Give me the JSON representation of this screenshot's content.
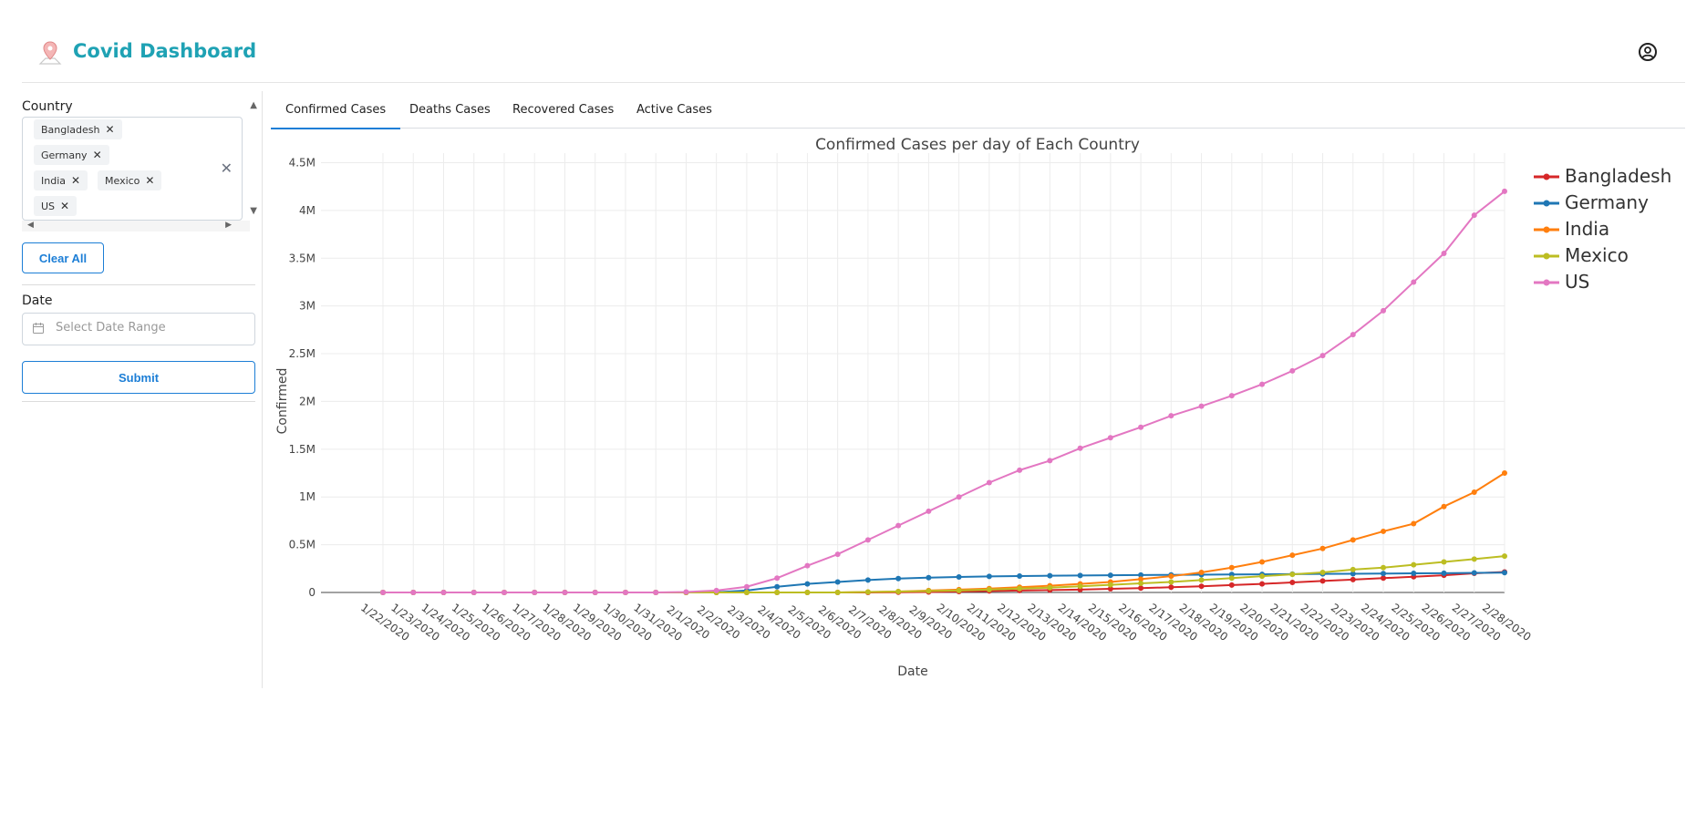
{
  "header": {
    "title": "Covid Dashboard",
    "logo_icon": "map-pin-icon",
    "profile_icon": "user-circle-icon"
  },
  "sidebar": {
    "country_label": "Country",
    "selected_countries": [
      "Bangladesh",
      "Germany",
      "India",
      "Mexico",
      "US"
    ],
    "clear_all_label": "Clear All",
    "date_label": "Date",
    "date_placeholder": "Select Date Range",
    "submit_label": "Submit"
  },
  "tabs": [
    "Confirmed Cases",
    "Deaths Cases",
    "Recovered Cases",
    "Active Cases"
  ],
  "active_tab": 0,
  "chart_data": {
    "type": "line",
    "title": "Confirmed Cases per day of Each Country",
    "xlabel": "Date",
    "ylabel": "Confirmed",
    "ylim": [
      0,
      4600000
    ],
    "yticks": [
      0,
      500000,
      1000000,
      1500000,
      2000000,
      2500000,
      3000000,
      3500000,
      4000000,
      4500000
    ],
    "ytick_labels": [
      "0",
      "0.5M",
      "1M",
      "1.5M",
      "2M",
      "2.5M",
      "3M",
      "3.5M",
      "4M",
      "4.5M"
    ],
    "categories": [
      "1/22/2020",
      "1/23/2020",
      "1/24/2020",
      "1/25/2020",
      "1/26/2020",
      "1/27/2020",
      "1/28/2020",
      "1/29/2020",
      "1/30/2020",
      "1/31/2020",
      "2/1/2020",
      "2/2/2020",
      "2/3/2020",
      "2/4/2020",
      "2/5/2020",
      "2/6/2020",
      "2/7/2020",
      "2/8/2020",
      "2/9/2020",
      "2/10/2020",
      "2/11/2020",
      "2/12/2020",
      "2/13/2020",
      "2/14/2020",
      "2/15/2020",
      "2/16/2020",
      "2/17/2020",
      "2/18/2020",
      "2/19/2020",
      "2/20/2020",
      "2/21/2020",
      "2/22/2020",
      "2/23/2020",
      "2/24/2020",
      "2/25/2020",
      "2/26/2020",
      "2/27/2020",
      "2/28/2020"
    ],
    "legend_position": "right",
    "grid": true,
    "series": [
      {
        "name": "Bangladesh",
        "color": "#d62728",
        "values": [
          0,
          0,
          0,
          0,
          0,
          0,
          0,
          0,
          0,
          0,
          0,
          0,
          0,
          0,
          0,
          0,
          0,
          2000,
          5000,
          9000,
          15000,
          20000,
          25000,
          30000,
          38000,
          45000,
          55000,
          65000,
          78000,
          90000,
          105000,
          120000,
          135000,
          150000,
          165000,
          180000,
          200000,
          215000
        ]
      },
      {
        "name": "Germany",
        "color": "#1f77b4",
        "values": [
          0,
          0,
          0,
          0,
          0,
          0,
          0,
          0,
          0,
          0,
          0,
          2000,
          20000,
          60000,
          90000,
          110000,
          130000,
          145000,
          155000,
          162000,
          168000,
          172000,
          175000,
          178000,
          180000,
          182000,
          184000,
          186000,
          188000,
          190000,
          192000,
          194000,
          196000,
          198000,
          200000,
          202000,
          205000,
          208000
        ]
      },
      {
        "name": "India",
        "color": "#ff7f0e",
        "values": [
          0,
          0,
          0,
          0,
          0,
          0,
          0,
          0,
          0,
          0,
          0,
          0,
          0,
          0,
          0,
          0,
          5000,
          10000,
          20000,
          30000,
          40000,
          55000,
          70000,
          90000,
          110000,
          140000,
          170000,
          210000,
          260000,
          320000,
          390000,
          460000,
          550000,
          640000,
          720000,
          900000,
          1050000,
          1250000
        ]
      },
      {
        "name": "Mexico",
        "color": "#bcbd22",
        "values": [
          0,
          0,
          0,
          0,
          0,
          0,
          0,
          0,
          0,
          0,
          0,
          0,
          0,
          0,
          0,
          0,
          5000,
          10000,
          15000,
          20000,
          30000,
          40000,
          50000,
          65000,
          80000,
          95000,
          110000,
          130000,
          150000,
          170000,
          190000,
          210000,
          240000,
          260000,
          290000,
          320000,
          350000,
          380000
        ]
      },
      {
        "name": "US",
        "color": "#e377c2",
        "values": [
          0,
          0,
          0,
          0,
          0,
          0,
          0,
          0,
          0,
          0,
          5000,
          20000,
          60000,
          150000,
          280000,
          400000,
          550000,
          700000,
          850000,
          1000000,
          1150000,
          1280000,
          1380000,
          1510000,
          1620000,
          1730000,
          1850000,
          1950000,
          2060000,
          2180000,
          2320000,
          2480000,
          2700000,
          2950000,
          3250000,
          3550000,
          3950000,
          4200000
        ]
      }
    ]
  }
}
